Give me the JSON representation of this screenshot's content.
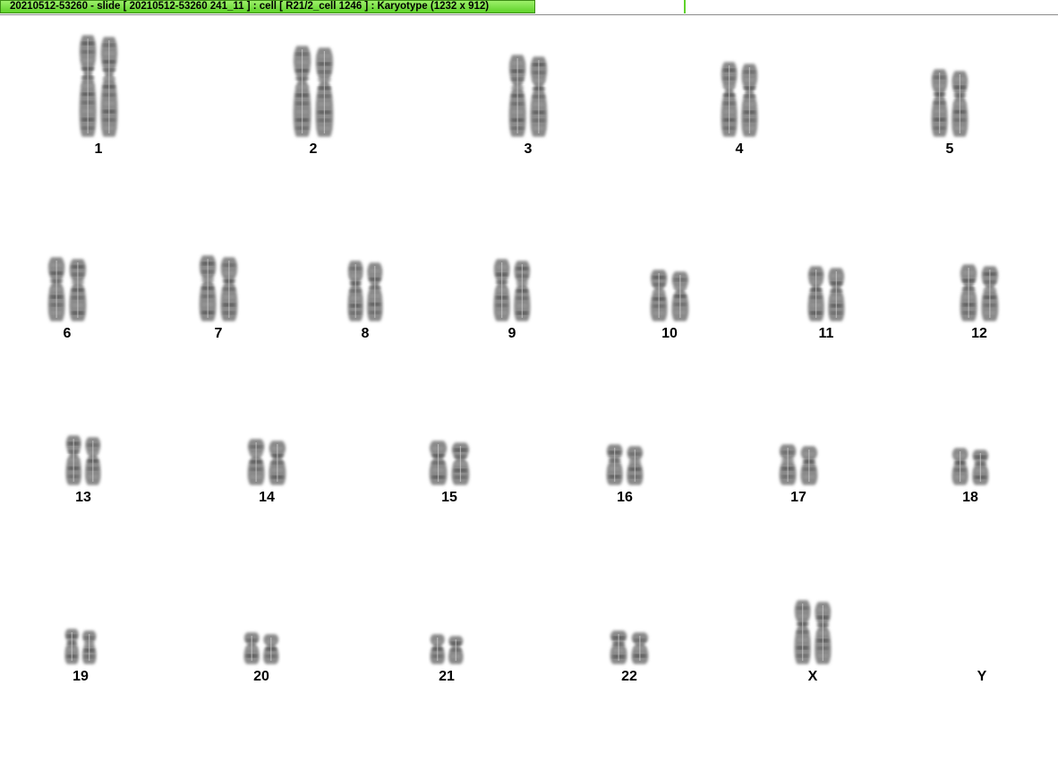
{
  "window": {
    "title": "20210512-53260 - slide [ 20210512-53260 241_11 ] : cell [ R21/2_cell 1246 ] : Karyotype  (1232 x 912)"
  },
  "karyotype": {
    "pairs": [
      {
        "label": "1"
      },
      {
        "label": "2"
      },
      {
        "label": "3"
      },
      {
        "label": "4"
      },
      {
        "label": "5"
      },
      {
        "label": "6"
      },
      {
        "label": "7"
      },
      {
        "label": "8"
      },
      {
        "label": "9"
      },
      {
        "label": "10"
      },
      {
        "label": "11"
      },
      {
        "label": "12"
      },
      {
        "label": "13"
      },
      {
        "label": "14"
      },
      {
        "label": "15"
      },
      {
        "label": "16"
      },
      {
        "label": "17"
      },
      {
        "label": "18"
      },
      {
        "label": "19"
      },
      {
        "label": "20"
      },
      {
        "label": "21"
      },
      {
        "label": "22"
      },
      {
        "label": "X"
      },
      {
        "label": "Y"
      }
    ]
  }
}
